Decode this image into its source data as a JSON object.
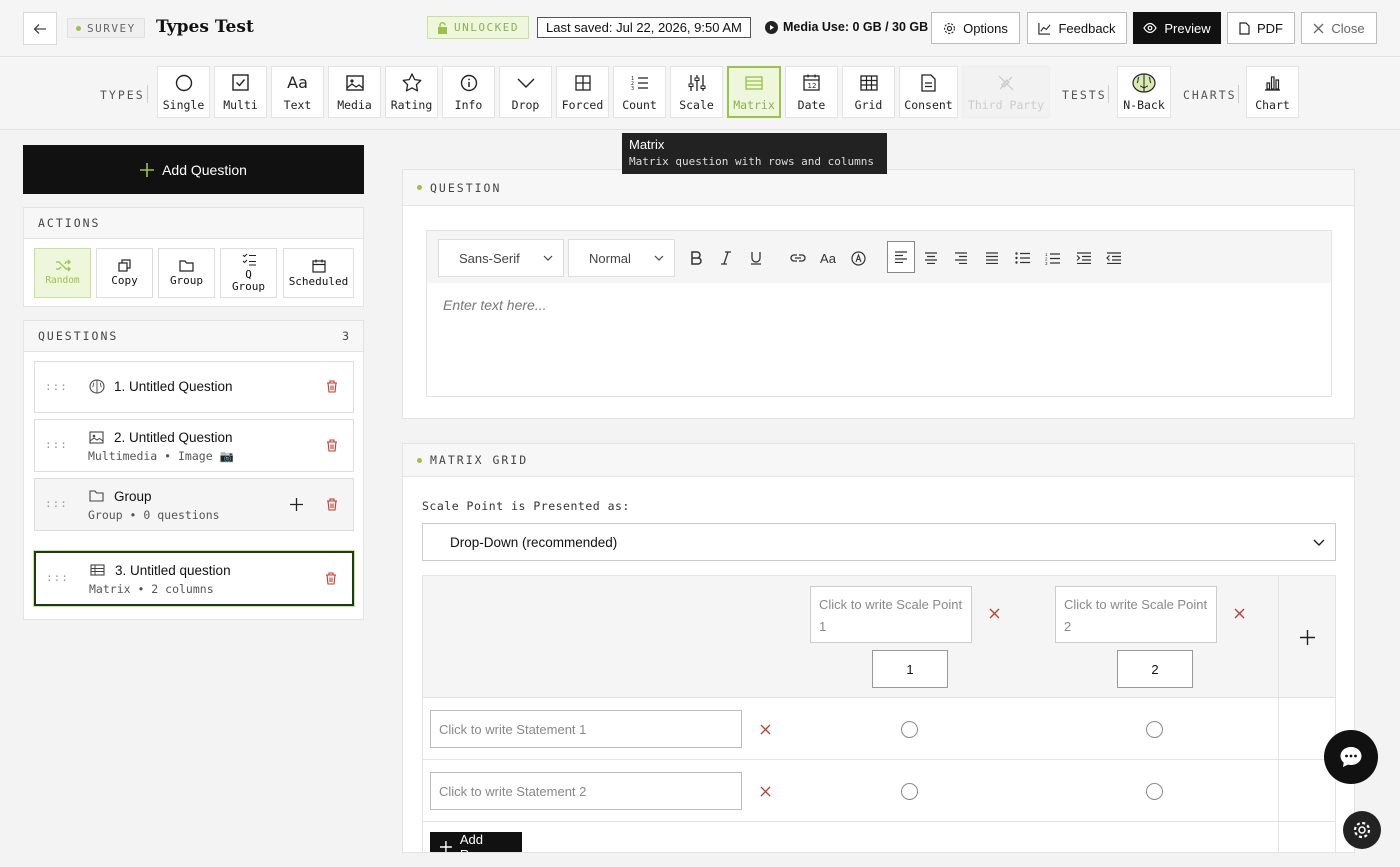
{
  "header": {
    "survey_badge": "SURVEY",
    "title": "Types Test",
    "lock_status": "UNLOCKED",
    "last_saved": "Last saved: Jul 22, 2026, 9:50 AM",
    "media_use": "Media Use: 0 GB / 30 GB",
    "buttons": {
      "options": "Options",
      "feedback": "Feedback",
      "preview": "Preview",
      "pdf": "PDF",
      "close": "Close"
    }
  },
  "toolbar": {
    "types_label": "TYPES",
    "tests_label": "TESTS",
    "charts_label": "CHARTS",
    "types": [
      {
        "label": "Single",
        "icon": "circle-icon"
      },
      {
        "label": "Multi",
        "icon": "checkbox-icon"
      },
      {
        "label": "Text",
        "icon": "text-icon"
      },
      {
        "label": "Media",
        "icon": "image-icon"
      },
      {
        "label": "Rating",
        "icon": "star-icon"
      },
      {
        "label": "Info",
        "icon": "info-icon"
      },
      {
        "label": "Drop",
        "icon": "chevron-down-icon"
      },
      {
        "label": "Forced",
        "icon": "grid-icon"
      },
      {
        "label": "Count",
        "icon": "list-ordered-icon"
      },
      {
        "label": "Scale",
        "icon": "sliders-icon"
      },
      {
        "label": "Matrix",
        "icon": "table-icon",
        "active": true
      },
      {
        "label": "Date",
        "icon": "calendar-icon"
      },
      {
        "label": "Grid",
        "icon": "grid-table-icon"
      },
      {
        "label": "Consent",
        "icon": "document-icon"
      },
      {
        "label": "Third Party",
        "icon": "plug-icon",
        "disabled": true
      }
    ],
    "tests": [
      {
        "label": "N-Back",
        "icon": "brain-icon"
      }
    ],
    "charts": [
      {
        "label": "Chart",
        "icon": "bar-chart-icon"
      }
    ]
  },
  "tooltip": {
    "title": "Matrix",
    "description": "Matrix question with rows and columns"
  },
  "sidebar": {
    "add_question": "Add Question",
    "actions_label": "ACTIONS",
    "actions": [
      {
        "label": "Random"
      },
      {
        "label": "Copy"
      },
      {
        "label": "Group"
      },
      {
        "label": "Q\nGroup"
      },
      {
        "label": "Scheduled"
      }
    ],
    "questions_label": "QUESTIONS",
    "questions_count": "3",
    "questions": [
      {
        "title": "1. Untitled Question",
        "subtitle": "",
        "icon": "brain-icon"
      },
      {
        "title": "2. Untitled Question",
        "subtitle": "Multimedia • Image 📷",
        "icon": "image-icon"
      },
      {
        "title": "Group",
        "subtitle": "Group • 0 questions",
        "icon": "folder-icon"
      },
      {
        "title": "3. Untitled question",
        "subtitle": "Matrix • 2 columns",
        "icon": "table-icon"
      }
    ]
  },
  "question_card": {
    "label": "QUESTION",
    "font_select": "Sans-Serif",
    "size_select": "Normal",
    "placeholder": "Enter text here..."
  },
  "matrix_card": {
    "label": "MATRIX GRID",
    "scale_label": "Scale Point is Presented as:",
    "presentation": "Drop-Down (recommended)",
    "scale_points": [
      {
        "placeholder": "Click to write Scale Point 1",
        "value": "1"
      },
      {
        "placeholder": "Click to write Scale Point 2",
        "value": "2"
      }
    ],
    "statements": [
      {
        "placeholder": "Click to write Statement 1"
      },
      {
        "placeholder": "Click to write Statement 2"
      }
    ],
    "add_row": "Add Row"
  },
  "colors": {
    "accent": "#9bc24a",
    "accent_bg": "#eef6dc",
    "danger": "#c0392b",
    "dark": "#111111"
  }
}
